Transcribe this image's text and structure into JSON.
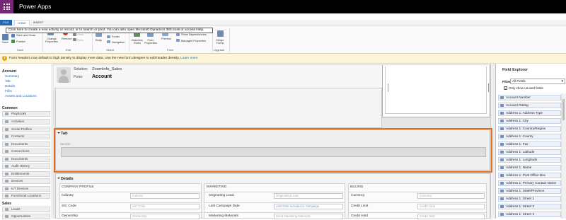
{
  "app": {
    "title": "Power Apps"
  },
  "ribbon": {
    "tabs": [
      "FILE",
      "HOME",
      "INSERT"
    ],
    "tooltip": "Click here to create a new activity or record, or to search or print. You can also open Microsoft Dynamics 365 tools or access Help.",
    "save": "Save",
    "save_close": "Save and Close",
    "publish": "Publish",
    "change_properties": "Change Properties",
    "remove": "Remove",
    "undo": "Undo",
    "redo": "Redo",
    "body": "Body",
    "header": "Header",
    "footer": "Footer",
    "navigation": "Navigation",
    "business_rules": "Business Rules",
    "form_properties": "Form Properties",
    "preview": "Preview",
    "show_dependencies": "Show Dependencies",
    "managed_properties": "Managed Properties",
    "merge_forms": "Merge Forms",
    "groups": {
      "save": "Save",
      "edit": "Edit",
      "select": "Select",
      "form": "Form",
      "upgrade": "Upgrade"
    }
  },
  "notification": {
    "text": "Form headers now default to high density to display more data. Use the new form designer to edit header density.",
    "link": "Learn more"
  },
  "nav": {
    "entity_header": "Account",
    "links": [
      "Summary",
      "Tab",
      "Details",
      "Files",
      "Assets and Locations"
    ],
    "common_header": "Common",
    "common_items": [
      "Playbooks",
      "Activities",
      "Social Profiles",
      "Contacts",
      "Documents",
      "Connections",
      "Documents",
      "Audit History",
      "Entitlements",
      "Devices",
      "IoT Devices",
      "Functional Locations"
    ],
    "sales_header": "Sales",
    "sales_items": [
      "Leads",
      "Opportunities"
    ]
  },
  "form_header": {
    "solution_label": "Solution:",
    "solution_value": "ZoomInfo_Sales",
    "form_label": "Form:",
    "form_value": "Account"
  },
  "tab_section": {
    "title": "Tab",
    "section_label": "Section"
  },
  "details": {
    "title": "Details",
    "columns": [
      {
        "header": "COMPANY PROFILE",
        "rows": [
          {
            "label": "Industry",
            "value": "Industry"
          },
          {
            "label": "SIC Code",
            "value": "SIC Code"
          },
          {
            "label": "Ownership",
            "value": "Ownership"
          }
        ]
      },
      {
        "header": "MARKETING",
        "rows": [
          {
            "label": "Originating Lead",
            "value": "Originating Lead"
          },
          {
            "label": "Last Campaign Date",
            "value": "Last Date Included in Campaign"
          },
          {
            "label": "Marketing Materials",
            "value": "Send Marketing Materials"
          }
        ]
      },
      {
        "header": "BILLING",
        "rows": [
          {
            "label": "Currency",
            "value": "Currency"
          },
          {
            "label": "Credit Limit",
            "value": "Credit Limit"
          },
          {
            "label": "Credit Hold",
            "value": "Credit Hold"
          }
        ]
      }
    ]
  },
  "field_explorer": {
    "title": "Field Explorer",
    "filter_label": "Filter",
    "filter_value": "All Fields",
    "only_unused_label": "Only show unused fields",
    "only_unused_checked": true,
    "fields": [
      "Account Number",
      "Account Rating",
      "Address 1: Address Type",
      "Address 1: City",
      "Address 1: Country/Region",
      "Address 1: County",
      "Address 1: Fax",
      "Address 1: Latitude",
      "Address 1: Longitude",
      "Address 1: Name",
      "Address 1: Post Office Box",
      "Address 1: Primary Contact Name",
      "Address 1: State/Province",
      "Address 1: Street 1",
      "Address 1: Street 2",
      "Address 1: Street 3"
    ]
  },
  "colors": {
    "topbar": "#000000",
    "waffle": "#742774",
    "accent": "#2266b8",
    "selection": "#e86a1e",
    "notification": "#fcf6d6"
  }
}
